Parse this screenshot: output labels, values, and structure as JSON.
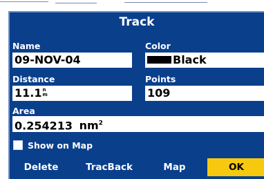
{
  "dialog": {
    "title": "Track",
    "name": {
      "label": "Name",
      "value": "09-NOV-04"
    },
    "color": {
      "label": "Color",
      "value": "Black",
      "swatch": "#000000"
    },
    "distance": {
      "label": "Distance",
      "value": "11.1",
      "unit_top": "n",
      "unit_bottom": "m"
    },
    "points": {
      "label": "Points",
      "value": "109"
    },
    "area": {
      "label": "Area",
      "value": "0.254213",
      "unit": "nm",
      "unit_exp": "2"
    },
    "show_on_map": {
      "label": "Show on Map",
      "checked": false
    },
    "buttons": {
      "delete": "Delete",
      "tracback": "TracBack",
      "map": "Map",
      "ok": "OK"
    }
  },
  "colors": {
    "dialog_bg": "#0a3f8c",
    "selected_button": "#f6c90e",
    "text": "#ffffff"
  }
}
